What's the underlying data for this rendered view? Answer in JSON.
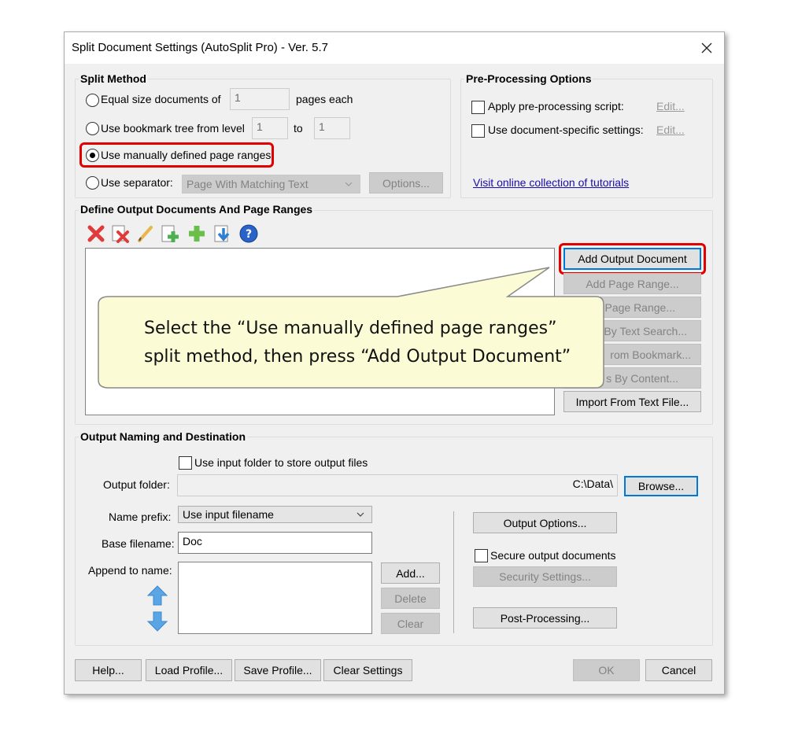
{
  "dialog": {
    "title": "Split Document Settings (AutoSplit Pro) - Ver. 5.7"
  },
  "split_method": {
    "label": "Split Method",
    "equal_size": {
      "label": "Equal size documents of",
      "value": "1",
      "suffix": "pages each",
      "selected": false
    },
    "bookmark": {
      "label": "Use bookmark tree from level",
      "from": "1",
      "to_label": "to",
      "to": "1",
      "selected": false
    },
    "manual": {
      "label": "Use manually defined page ranges",
      "selected": true
    },
    "separator": {
      "label": "Use separator:",
      "value": "Page With Matching Text",
      "options_button": "Options...",
      "selected": false
    }
  },
  "preprocessing": {
    "label": "Pre-Processing Options",
    "script": {
      "label": "Apply pre-processing script:",
      "checked": false,
      "edit": "Edit..."
    },
    "doc_specific": {
      "label": "Use document-specific settings:",
      "checked": false,
      "edit": "Edit..."
    },
    "tutorials_link": "Visit online collection of tutorials"
  },
  "define_output": {
    "label": "Define Output Documents And Page Ranges",
    "toolbar_icons": [
      "delete-icon",
      "delete-all-icon",
      "edit-pencil-icon",
      "add-document-icon",
      "add-icon",
      "move-down-icon",
      "help-icon"
    ],
    "buttons": [
      {
        "label": "Add Output Document",
        "enabled": true
      },
      {
        "label": "Add Page Range...",
        "enabled": false
      },
      {
        "label": "Page Range...",
        "enabled": false
      },
      {
        "label": "By Text Search...",
        "enabled": false
      },
      {
        "label": "rom Bookmark...",
        "enabled": false
      },
      {
        "label": "s By Content...",
        "enabled": false
      },
      {
        "label": "Import From Text File...",
        "enabled": true
      }
    ]
  },
  "callout": {
    "line1": "Select the “Use manually defined page ranges”",
    "line2": "split method, then press “Add Output Document”",
    "fill": "#fbfbd5",
    "border": "#8a8a8a"
  },
  "output_naming": {
    "label": "Output Naming and Destination",
    "use_input_folder": {
      "label": "Use input folder to store output files",
      "checked": false
    },
    "output_folder_label": "Output folder:",
    "output_folder_value": "C:\\Data\\",
    "browse_button": "Browse...",
    "name_prefix_label": "Name prefix:",
    "name_prefix_value": "Use input filename",
    "base_filename_label": "Base filename:",
    "base_filename_value": "Doc",
    "append_label": "Append to name:",
    "add_button": "Add...",
    "delete_button": "Delete",
    "clear_button": "Clear",
    "output_options_button": "Output Options...",
    "secure": {
      "label": "Secure output documents",
      "checked": false
    },
    "security_settings_button": "Security Settings...",
    "post_processing_button": "Post-Processing..."
  },
  "footer": {
    "help": "Help...",
    "load_profile": "Load Profile...",
    "save_profile": "Save Profile...",
    "clear_settings": "Clear Settings",
    "ok": "OK",
    "cancel": "Cancel"
  },
  "colors": {
    "highlight": "#e00000",
    "dialog_bg": "#f0f0f0",
    "link": "#1a0dab",
    "arrow_icon": "#5aa5e6"
  }
}
